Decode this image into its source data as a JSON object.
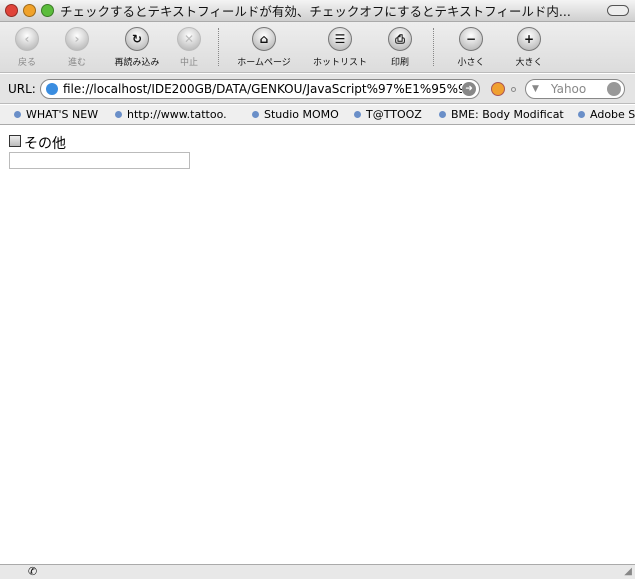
{
  "window": {
    "title": "チェックするとテキストフィールドが有効、チェックオフにするとテキストフィールド内..."
  },
  "toolbar": {
    "back": "戻る",
    "forward": "進む",
    "reload": "再読み込み",
    "stop": "中止",
    "home": "ホームページ",
    "hotlist": "ホットリスト",
    "print": "印刷",
    "smaller": "小さく",
    "larger": "大きく"
  },
  "urlbar": {
    "label": "URL:",
    "value": "file://localhost/IDE200GB/DATA/GENKOU/JavaScript%97%E1%95%9",
    "search_placeholder": "Yahoo"
  },
  "bookmarks": [
    "WHAT'S NEW",
    "http://www.tattoo.",
    "Studio MOMO",
    "T@TTOOZ",
    "BME: Body Modificat",
    "Adobe S"
  ],
  "page": {
    "checkbox_label": "その他",
    "text_value": ""
  }
}
